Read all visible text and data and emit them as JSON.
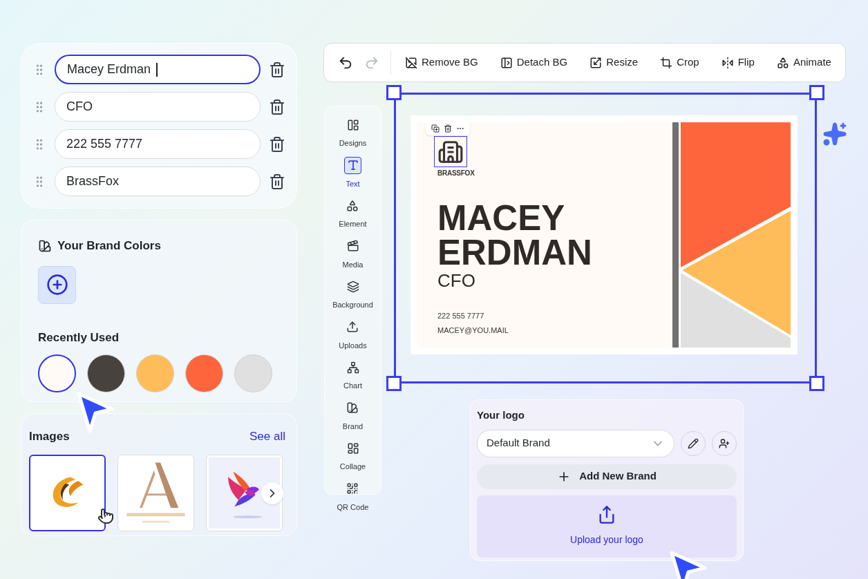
{
  "fields": [
    {
      "value": "Macey Erdman",
      "focused": true
    },
    {
      "value": "CFO",
      "focused": false
    },
    {
      "value": "222 555 7777",
      "focused": false
    },
    {
      "value": "BrassFox",
      "focused": false
    }
  ],
  "brand_colors": {
    "title": "Your Brand Colors"
  },
  "recently_used": {
    "title": "Recently Used",
    "swatches": [
      {
        "color": "#fffaf5",
        "selected": true
      },
      {
        "color": "#47423d",
        "selected": false
      },
      {
        "color": "#ffbd59",
        "selected": false
      },
      {
        "color": "#ff653d",
        "selected": false
      },
      {
        "color": "#e0e0e0",
        "selected": false
      }
    ]
  },
  "images": {
    "title": "Images",
    "link": "See all",
    "items": [
      {
        "kind": "picture",
        "selected": true
      },
      {
        "kind": "picture",
        "selected": false
      },
      {
        "kind": "picture",
        "selected": false
      }
    ]
  },
  "toolbar": {
    "history": [
      {
        "kind": "undo",
        "disabled": false
      },
      {
        "kind": "redo",
        "disabled": true
      }
    ],
    "tools": [
      {
        "kind": "remove-bg",
        "label": "Remove BG"
      },
      {
        "kind": "detach-bg",
        "label": "Detach BG"
      },
      {
        "kind": "resize",
        "label": "Resize"
      },
      {
        "kind": "crop",
        "label": "Crop"
      },
      {
        "kind": "flip",
        "label": "Flip"
      },
      {
        "kind": "animate",
        "label": "Animate"
      }
    ]
  },
  "rail": [
    {
      "kind": "designs",
      "label": "Designs",
      "selected": false
    },
    {
      "kind": "text",
      "label": "Text",
      "selected": true
    },
    {
      "kind": "element",
      "label": "Element",
      "selected": false
    },
    {
      "kind": "media",
      "label": "Media",
      "selected": false
    },
    {
      "kind": "background",
      "label": "Background",
      "selected": false
    },
    {
      "kind": "uploads",
      "label": "Uploads",
      "selected": false
    },
    {
      "kind": "chart",
      "label": "Chart",
      "selected": false
    },
    {
      "kind": "brand",
      "label": "Brand",
      "selected": false
    },
    {
      "kind": "collage",
      "label": "Collage",
      "selected": false
    },
    {
      "kind": "qr",
      "label": "QR Code",
      "selected": false
    }
  ],
  "card": {
    "logo_text": "BRASSFOX",
    "name_lines": [
      "MACEY",
      "ERDMAN"
    ],
    "title": "CFO",
    "phone": "222 555 7777",
    "email": "MACEY@YOU.MAIL"
  },
  "logo_panel": {
    "title": "Your logo",
    "brand_select": "Default Brand",
    "add_button": "Add New Brand",
    "upload_label": "Upload your logo"
  }
}
